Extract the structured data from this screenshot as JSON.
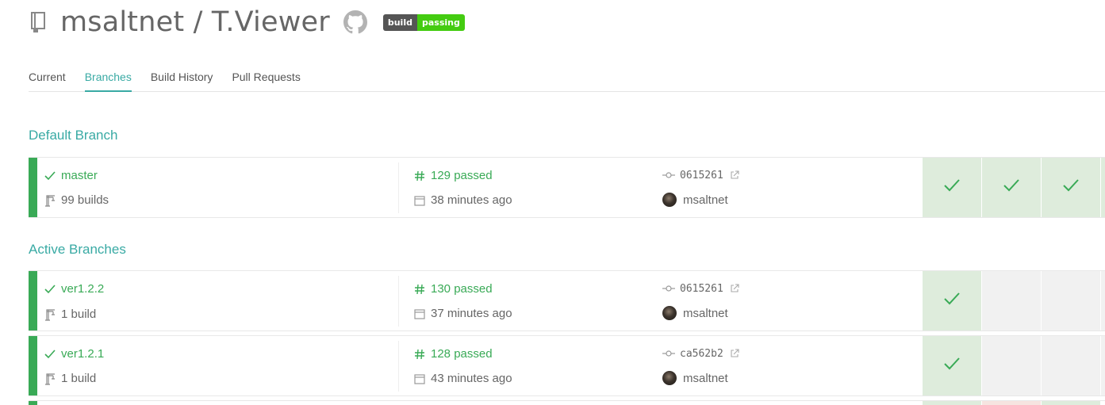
{
  "header": {
    "title": "msaltnet / T.Viewer",
    "repo_icon": "repo-icon",
    "github_icon": "github-icon",
    "badge": {
      "left": "build",
      "right": "passing"
    }
  },
  "tabs": [
    {
      "label": "Current",
      "active": false
    },
    {
      "label": "Branches",
      "active": true
    },
    {
      "label": "Build History",
      "active": false
    },
    {
      "label": "Pull Requests",
      "active": false
    }
  ],
  "sections": {
    "default_title": "Default Branch",
    "active_title": "Active Branches"
  },
  "default_branch": {
    "name": "master",
    "builds": "99 builds",
    "build_status": "129 passed",
    "time": "38 minutes ago",
    "commit": "0615261",
    "author": "msaltnet",
    "tiles": [
      "pass",
      "pass",
      "pass"
    ]
  },
  "active_branches": [
    {
      "name": "ver1.2.2",
      "builds": "1 build",
      "build_status": "130 passed",
      "time": "37 minutes ago",
      "commit": "0615261",
      "author": "msaltnet",
      "tiles": [
        "pass",
        "empty",
        "empty"
      ]
    },
    {
      "name": "ver1.2.1",
      "builds": "1 build",
      "build_status": "128 passed",
      "time": "43 minutes ago",
      "commit": "ca562b2",
      "author": "msaltnet",
      "tiles": [
        "pass",
        "empty",
        "empty"
      ]
    }
  ],
  "colors": {
    "accent": "#39aaa4",
    "passed": "#39aa56",
    "passed_tile": "#deecdc",
    "empty_tile": "#f1f1f1",
    "failed_tile": "#f6e4e0"
  }
}
